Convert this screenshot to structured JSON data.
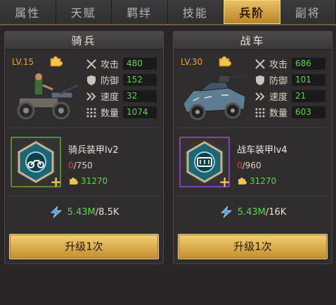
{
  "tabs": [
    {
      "label": "属性"
    },
    {
      "label": "天赋"
    },
    {
      "label": "羁绊"
    },
    {
      "label": "技能"
    },
    {
      "label": "兵阶",
      "active": true
    },
    {
      "label": "副将"
    }
  ],
  "panels": [
    {
      "title": "骑兵",
      "level": "LV.15",
      "stats": [
        {
          "label": "攻击",
          "value": "480",
          "icon": "sword-icon"
        },
        {
          "label": "防御",
          "value": "152",
          "icon": "shield-icon"
        },
        {
          "label": "速度",
          "value": "32",
          "icon": "speed-icon"
        },
        {
          "label": "数量",
          "value": "1074",
          "icon": "troops-icon"
        }
      ],
      "equip": {
        "name": "骑兵装甲lv2",
        "current": "0",
        "total": "/750",
        "cost": "31270",
        "rarity_color": "#5a8a2a"
      },
      "resource": {
        "have": "5.43M",
        "need": "/8.5K"
      },
      "button": "升级1次"
    },
    {
      "title": "战车",
      "level": "LV.30",
      "stats": [
        {
          "label": "攻击",
          "value": "686",
          "icon": "sword-icon"
        },
        {
          "label": "防御",
          "value": "101",
          "icon": "shield-icon"
        },
        {
          "label": "速度",
          "value": "21",
          "icon": "speed-icon"
        },
        {
          "label": "数量",
          "value": "603",
          "icon": "troops-icon"
        }
      ],
      "equip": {
        "name": "战车装甲lv4",
        "current": "0",
        "total": "/960",
        "cost": "31270",
        "rarity_color": "#8a3fb0"
      },
      "resource": {
        "have": "5.43M",
        "need": "/16K"
      },
      "button": "升级1次"
    }
  ]
}
